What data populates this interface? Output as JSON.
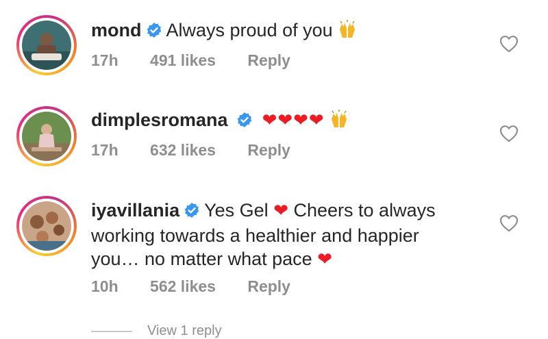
{
  "comments": [
    {
      "username": "mond",
      "text": "Always proud of you",
      "time": "17h",
      "likes": "491 likes",
      "reply": "Reply"
    },
    {
      "username": "dimplesromana",
      "hearts": "❤❤❤❤",
      "time": "17h",
      "likes": "632 likes",
      "reply": "Reply"
    },
    {
      "username": "iyavillania",
      "text_part1": "Yes Gel",
      "text_part2": "Cheers to always working towards a healthier and happier you… no matter what pace",
      "heart": "❤",
      "time": "10h",
      "likes": "562 likes",
      "reply": "Reply"
    }
  ],
  "view_replies": "View 1 reply",
  "icons": {
    "verified": "verified-badge-icon",
    "like": "heart-outline-icon",
    "raised_hands": "raising-hands-emoji-icon"
  },
  "colors": {
    "verified_blue": "#3897f0",
    "meta_gray": "#8e8e8e",
    "heart_red": "#ed1c24"
  }
}
